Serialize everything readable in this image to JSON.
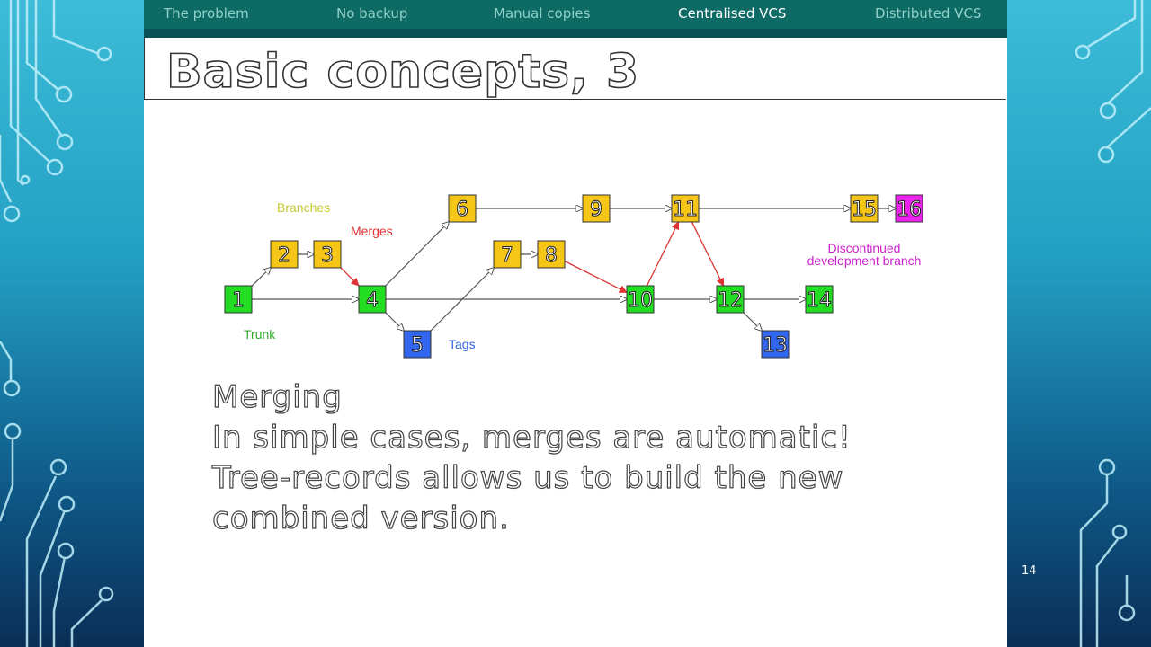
{
  "nav": {
    "items": [
      "The problem",
      "No backup",
      "Manual copies",
      "Centralised VCS",
      "Distributed VCS"
    ],
    "active": "Centralised VCS"
  },
  "slide": {
    "title": "Basic concepts, 3",
    "body_lines": [
      "Merging",
      "In simple cases, merges are automatic!",
      "Tree-records allows us to build the new",
      "combined version."
    ],
    "page_number": "14"
  },
  "diagram": {
    "labels": {
      "branches": "Branches",
      "merges": "Merges",
      "trunk": "Trunk",
      "tags": "Tags",
      "discontinued_line1": "Discontinued",
      "discontinued_line2": "development branch"
    },
    "colors": {
      "trunk": "#22dd22",
      "branch": "#f5c518",
      "tag": "#3366ee",
      "discontinued": "#ee22ee",
      "merge_arrow": "#dd3333",
      "branches_label": "#c8c832",
      "merges_label": "#dd3333",
      "trunk_label": "#33aa33",
      "tags_label": "#3366dd",
      "discontinued_label": "#cc22cc"
    },
    "nodes": [
      {
        "id": "1",
        "kind": "trunk"
      },
      {
        "id": "2",
        "kind": "branch"
      },
      {
        "id": "3",
        "kind": "branch"
      },
      {
        "id": "4",
        "kind": "trunk"
      },
      {
        "id": "5",
        "kind": "tag"
      },
      {
        "id": "6",
        "kind": "branch"
      },
      {
        "id": "7",
        "kind": "branch"
      },
      {
        "id": "8",
        "kind": "branch"
      },
      {
        "id": "9",
        "kind": "branch"
      },
      {
        "id": "10",
        "kind": "trunk"
      },
      {
        "id": "11",
        "kind": "branch"
      },
      {
        "id": "12",
        "kind": "trunk"
      },
      {
        "id": "13",
        "kind": "tag"
      },
      {
        "id": "14",
        "kind": "trunk"
      },
      {
        "id": "15",
        "kind": "branch"
      },
      {
        "id": "16",
        "kind": "discontinued"
      }
    ],
    "edges": [
      {
        "from": "1",
        "to": "2",
        "kind": "normal"
      },
      {
        "from": "2",
        "to": "3",
        "kind": "normal"
      },
      {
        "from": "3",
        "to": "4",
        "kind": "merge"
      },
      {
        "from": "1",
        "to": "4",
        "kind": "normal"
      },
      {
        "from": "4",
        "to": "6",
        "kind": "normal"
      },
      {
        "from": "4",
        "to": "5",
        "kind": "normal"
      },
      {
        "from": "4",
        "to": "10",
        "kind": "normal"
      },
      {
        "from": "5",
        "to": "7",
        "kind": "normal"
      },
      {
        "from": "7",
        "to": "8",
        "kind": "normal"
      },
      {
        "from": "8",
        "to": "10",
        "kind": "merge"
      },
      {
        "from": "6",
        "to": "9",
        "kind": "normal"
      },
      {
        "from": "9",
        "to": "11",
        "kind": "normal"
      },
      {
        "from": "10",
        "to": "11",
        "kind": "merge"
      },
      {
        "from": "10",
        "to": "12",
        "kind": "normal"
      },
      {
        "from": "11",
        "to": "12",
        "kind": "merge"
      },
      {
        "from": "11",
        "to": "15",
        "kind": "normal"
      },
      {
        "from": "12",
        "to": "14",
        "kind": "normal"
      },
      {
        "from": "12",
        "to": "13",
        "kind": "normal"
      },
      {
        "from": "15",
        "to": "16",
        "kind": "normal"
      }
    ]
  }
}
